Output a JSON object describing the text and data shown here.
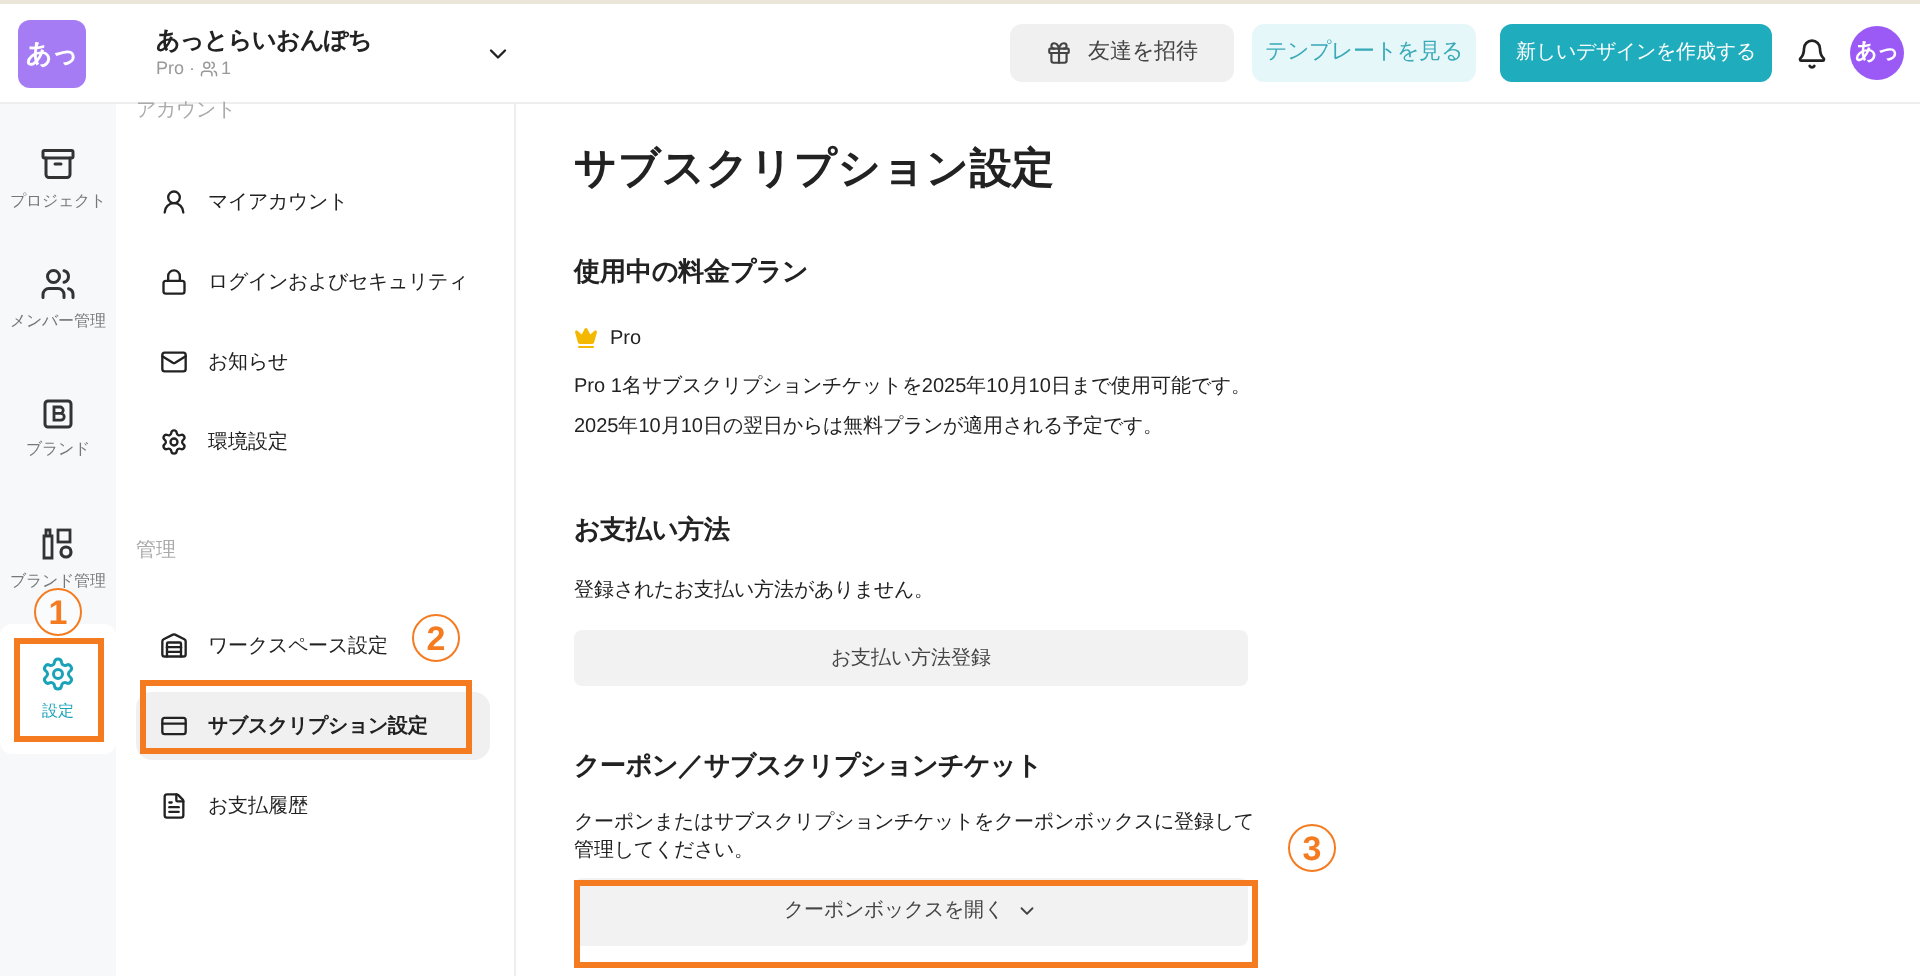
{
  "workspace": {
    "avatar": "あっ",
    "name": "あっとらいおんぽち",
    "plan": "Pro ·",
    "members": "1"
  },
  "header": {
    "invite": "友達を招待",
    "templates": "テンプレートを見る",
    "create": "新しいデザインを作成する",
    "user_avatar": "あっ"
  },
  "rail": [
    {
      "kind": "project",
      "label": "プロジェクト",
      "selected": false
    },
    {
      "kind": "members",
      "label": "メンバー管理",
      "selected": false
    },
    {
      "kind": "brand",
      "label": "ブランド",
      "selected": false
    },
    {
      "kind": "brandmanage",
      "label": "ブランド管理",
      "selected": false
    },
    {
      "kind": "settings",
      "label": "設定",
      "selected": true
    }
  ],
  "nav": [
    {
      "heading": "アカウント",
      "items": [
        {
          "kind": "account",
          "label": "マイアカウント",
          "selected": false
        },
        {
          "kind": "lock",
          "label": "ログインおよびセキュリティ",
          "selected": false
        },
        {
          "kind": "mail",
          "label": "お知らせ",
          "selected": false
        },
        {
          "kind": "gear",
          "label": "環境設定",
          "selected": false
        }
      ]
    },
    {
      "heading": "管理",
      "items": [
        {
          "kind": "workspace",
          "label": "ワークスペース設定",
          "selected": false
        },
        {
          "kind": "card",
          "label": "サブスクリプション設定",
          "selected": true
        },
        {
          "kind": "doc",
          "label": "お支払履歴",
          "selected": false
        }
      ]
    }
  ],
  "content": {
    "title": "サブスクリプション設定",
    "plan": {
      "heading": "使用中の料金プラン",
      "name": "Pro",
      "lines": [
        "Pro 1名サブスクリプションチケットを2025年10月10日まで使用可能です。",
        "2025年10月10日の翌日からは無料プランが適用される予定です。"
      ]
    },
    "payment": {
      "heading": "お支払い方法",
      "message": "登録されたお支払い方法がありません。",
      "button": "お支払い方法登録"
    },
    "coupon": {
      "heading": "クーポン／サブスクリプションチケット",
      "message": "クーポンまたはサブスクリプションチケットをクーポンボックスに登録して管理してください。",
      "button": "クーポンボックスを開く"
    }
  },
  "annotations": [
    {
      "number": "1"
    },
    {
      "number": "2"
    },
    {
      "number": "3"
    }
  ]
}
